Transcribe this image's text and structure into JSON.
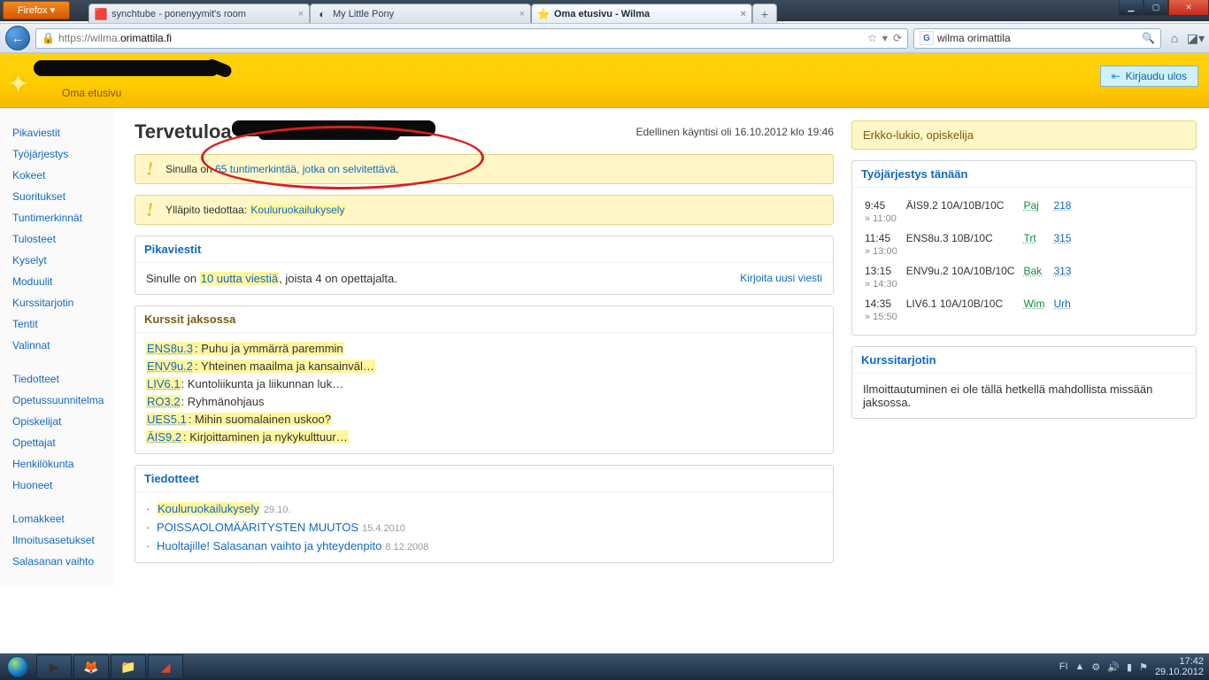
{
  "browser": {
    "firefox_label": "Firefox ▾",
    "tabs": [
      {
        "title": "synchtube - ponenyymit's room",
        "fav": "🟥"
      },
      {
        "title": "My Little Pony",
        "fav": "◐"
      },
      {
        "title": "Oma etusivu - Wilma",
        "fav": "⭐",
        "active": true
      }
    ],
    "url_display": "https://wilma.orimattila.fi",
    "url_host": "orimattila.fi",
    "search_query": "wilma orimattila"
  },
  "window": {
    "min": "▁",
    "max": "▢",
    "close": "✕"
  },
  "header": {
    "subtitle": "Oma etusivu",
    "logout_label": "Kirjaudu ulos"
  },
  "sidebar1": [
    "Pikaviestit",
    "Työjärjestys",
    "Kokeet",
    "Suoritukset",
    "Tuntimerkinnät",
    "Tulosteet",
    "Kyselyt",
    "Moduulit",
    "Kurssitarjotin",
    "Tentit",
    "Valinnat"
  ],
  "sidebar2": [
    "Tiedotteet",
    "Opetussuunnitelma",
    "Opiskelijat",
    "Opettajat",
    "Henkilökunta",
    "Huoneet"
  ],
  "sidebar3": [
    "Lomakkeet",
    "Ilmoitusasetukset",
    "Salasanan vaihto"
  ],
  "main": {
    "welcome": "Tervetuloa",
    "last_visit": "Edellinen käyntisi oli 16.10.2012 klo 19:46",
    "alert1_pre": "Sinulla on ",
    "alert1_link": "65 tuntimerkintää, jotka on selvitettävä",
    "alert1_post": ".",
    "alert2_pre": "Ylläpito tiedottaa: ",
    "alert2_link": "Kouluruokailukysely",
    "msgs_title": "Pikaviestit",
    "msgs_pre": "Sinulle on ",
    "msgs_link": "10 uutta viestiä",
    "msgs_post": ", joista 4 on opettajalta.",
    "msgs_write": "Kirjoita uusi viesti",
    "courses_title": "Kurssit jaksossa",
    "courses": [
      {
        "code": "ENS8u.3",
        "desc": "Puhu ja ymmärrä paremmin",
        "hl": true
      },
      {
        "code": "ENV9u.2",
        "desc": "Yhteinen maailma ja kansainväl…",
        "hl": true
      },
      {
        "code": "LIV6.1",
        "desc": "Kuntoliikunta ja liikunnan luk…"
      },
      {
        "code": "RO3.2",
        "desc": "Ryhmänohjaus"
      },
      {
        "code": "UES5.1",
        "desc": "Mihin suomalainen uskoo?",
        "hl": true
      },
      {
        "code": "ÄIS9.2",
        "desc": "Kirjoittaminen ja nykykulttuur…",
        "hl": true
      }
    ],
    "news_title": "Tiedotteet",
    "news": [
      {
        "title": "Kouluruokailukysely",
        "date": "29.10.",
        "hl": true
      },
      {
        "title": "POISSAOLOMÄÄRITYSTEN MUUTOS",
        "date": "15.4.2010"
      },
      {
        "title": "Huoltajille! Salasanan vaihto ja yhteydenpito",
        "date": "8.12.2008"
      }
    ]
  },
  "right": {
    "status": "Erkko-lukio, opiskelija",
    "sched_title": "Työjärjestys tänään",
    "schedule": [
      {
        "time": "9:45",
        "end": "» 11:00",
        "subj": "ÄIS9.2 10A/10B/10C",
        "teacher": "Paj",
        "room": "218"
      },
      {
        "time": "11:45",
        "end": "» 13:00",
        "subj": "ENS8u.3 10B/10C",
        "teacher": "Trt",
        "room": "315"
      },
      {
        "time": "13:15",
        "end": "» 14:30",
        "subj": "ENV9u.2 10A/10B/10C",
        "teacher": "Bak",
        "room": "313"
      },
      {
        "time": "14:35",
        "end": "» 15:50",
        "subj": "LIV6.1 10A/10B/10C",
        "teacher": "Wim",
        "room": "Urh"
      }
    ],
    "tray_title": "Kurssitarjotin",
    "tray_body": "Ilmoittautuminen ei ole tällä hetkellä mahdollista missään jaksossa."
  },
  "taskbar": {
    "lang": "FI",
    "time": "17:42",
    "date": "29.10.2012"
  }
}
